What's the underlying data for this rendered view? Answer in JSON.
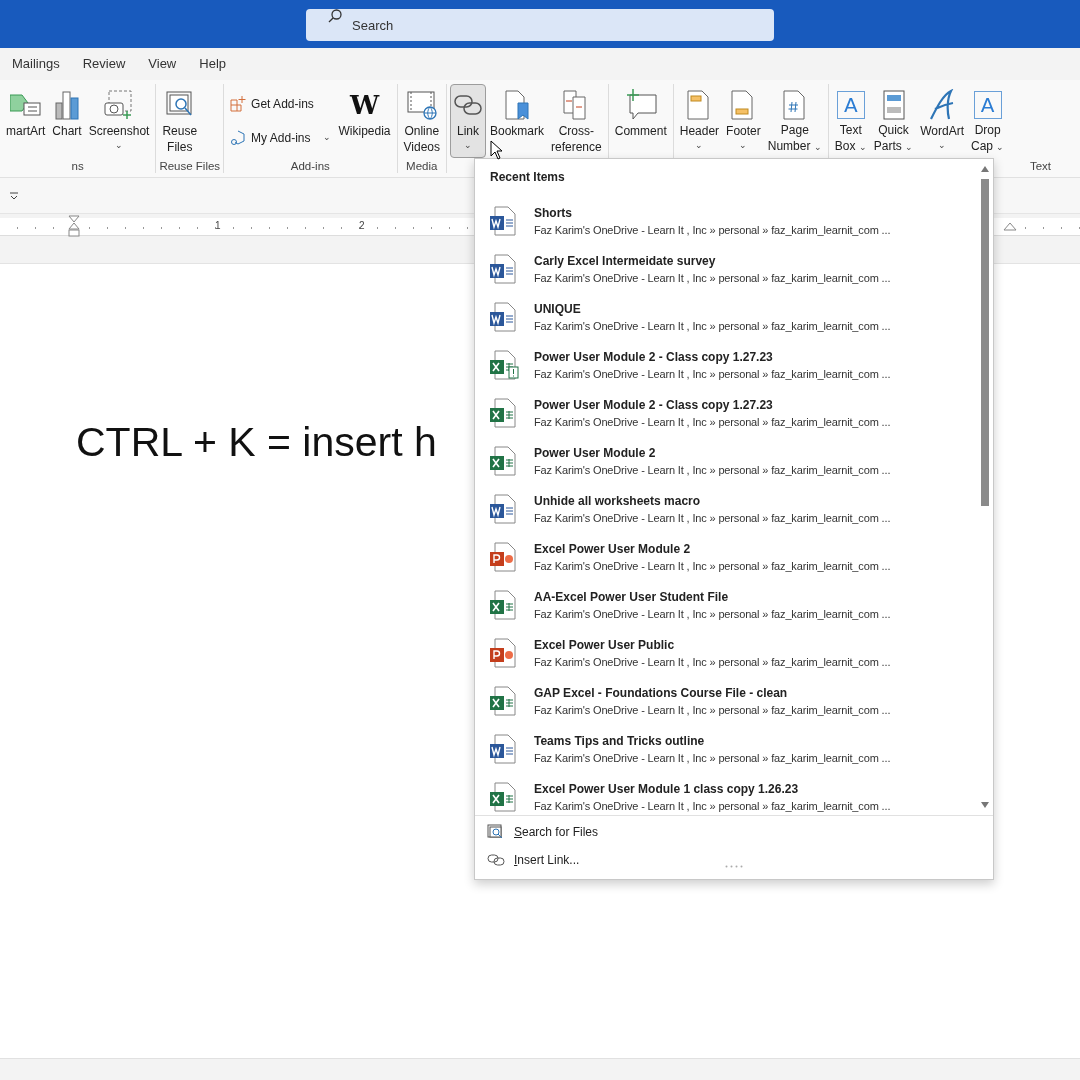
{
  "search": {
    "placeholder": "Search"
  },
  "tabs": [
    "Mailings",
    "Review",
    "View",
    "Help"
  ],
  "ribbon": {
    "groups": [
      {
        "label": "ns",
        "buttons": [
          {
            "kind": "large",
            "label": "martArt"
          },
          {
            "kind": "large",
            "label": "Chart"
          },
          {
            "kind": "large",
            "label": "Screenshot",
            "caret": "⌄"
          }
        ]
      },
      {
        "label": "Reuse Files",
        "buttons": [
          {
            "kind": "large",
            "label": "Reuse\nFiles"
          }
        ]
      },
      {
        "label": "Add-ins",
        "buttons": [
          {
            "kind": "small",
            "label": "Get Add-ins"
          },
          {
            "kind": "small",
            "label": "My Add-ins",
            "caret": "⌄"
          },
          {
            "kind": "large",
            "label": "Wikipedia",
            "icon_text": "W"
          }
        ]
      },
      {
        "label": "Media",
        "buttons": [
          {
            "kind": "large",
            "label": "Online\nVideos"
          }
        ]
      },
      {
        "buttons": [
          {
            "kind": "large",
            "label": "Link",
            "caret": "⌄",
            "pressed": true
          },
          {
            "kind": "large",
            "label": "Bookmark"
          },
          {
            "kind": "large",
            "label": "Cross-\nreference"
          }
        ]
      },
      {
        "buttons": [
          {
            "kind": "large",
            "label": "Comment"
          }
        ]
      },
      {
        "buttons": [
          {
            "kind": "large",
            "label": "Header",
            "caret": "⌄"
          },
          {
            "kind": "large",
            "label": "Footer",
            "caret": "⌄"
          },
          {
            "kind": "large",
            "label": "Page\nNumber",
            "caret": "⌄"
          }
        ]
      },
      {
        "label": "Text",
        "buttons": [
          {
            "kind": "large",
            "label": "Text\nBox",
            "icon_text": "A",
            "caret": "⌄"
          },
          {
            "kind": "large",
            "label": "Quick\nParts",
            "caret": "⌄"
          },
          {
            "kind": "large",
            "label": "WordArt",
            "caret": "⌄"
          },
          {
            "kind": "large",
            "label": "Drop\nCap",
            "icon_text": "A",
            "caret": "⌄"
          }
        ]
      }
    ]
  },
  "ruler": {
    "numbers": [
      "1",
      "2"
    ]
  },
  "document": {
    "text": "CTRL + K = insert h"
  },
  "link_menu": {
    "heading": "Recent Items",
    "items": [
      {
        "kind": "word",
        "title": "Shorts",
        "path": "Faz Karim's OneDrive - Learn It , Inc » personal » faz_karim_learnit_com ..."
      },
      {
        "kind": "word",
        "title": "Carly Excel Intermeidate survey",
        "path": "Faz Karim's OneDrive - Learn It , Inc » personal » faz_karim_learnit_com ..."
      },
      {
        "kind": "word",
        "title": "UNIQUE",
        "path": "Faz Karim's OneDrive - Learn It , Inc » personal » faz_karim_learnit_com ..."
      },
      {
        "kind": "excel_alert",
        "title": "Power User Module 2 - Class copy 1.27.23",
        "path": "Faz Karim's OneDrive - Learn It , Inc » personal » faz_karim_learnit_com ..."
      },
      {
        "kind": "excel",
        "title": "Power User Module 2 - Class copy 1.27.23",
        "path": "Faz Karim's OneDrive - Learn It , Inc » personal » faz_karim_learnit_com ..."
      },
      {
        "kind": "excel",
        "title": "Power User Module 2",
        "path": "Faz Karim's OneDrive - Learn It , Inc » personal » faz_karim_learnit_com ..."
      },
      {
        "kind": "word",
        "title": "Unhide all worksheets macro",
        "path": "Faz Karim's OneDrive - Learn It , Inc » personal » faz_karim_learnit_com ..."
      },
      {
        "kind": "powerpoint",
        "title": "Excel Power User Module 2",
        "path": "Faz Karim's OneDrive - Learn It , Inc » personal » faz_karim_learnit_com ..."
      },
      {
        "kind": "excel",
        "title": "AA-Excel Power User Student File",
        "path": "Faz Karim's OneDrive - Learn It , Inc » personal » faz_karim_learnit_com ..."
      },
      {
        "kind": "powerpoint",
        "title": "Excel Power User Public",
        "path": "Faz Karim's OneDrive - Learn It , Inc » personal » faz_karim_learnit_com ..."
      },
      {
        "kind": "excel",
        "title": "GAP Excel - Foundations Course File - clean",
        "path": "Faz Karim's OneDrive - Learn It , Inc » personal » faz_karim_learnit_com ..."
      },
      {
        "kind": "word",
        "title": "Teams Tips and Tricks outline",
        "path": "Faz Karim's OneDrive - Learn It , Inc » personal » faz_karim_learnit_com ..."
      },
      {
        "kind": "excel",
        "title": "Excel Power User Module 1 class copy 1.26.23",
        "path": "Faz Karim's OneDrive - Learn It , Inc » personal » faz_karim_learnit_com ..."
      }
    ],
    "actions": [
      {
        "label": "Search for Files"
      },
      {
        "label": "Insert Link..."
      }
    ]
  }
}
